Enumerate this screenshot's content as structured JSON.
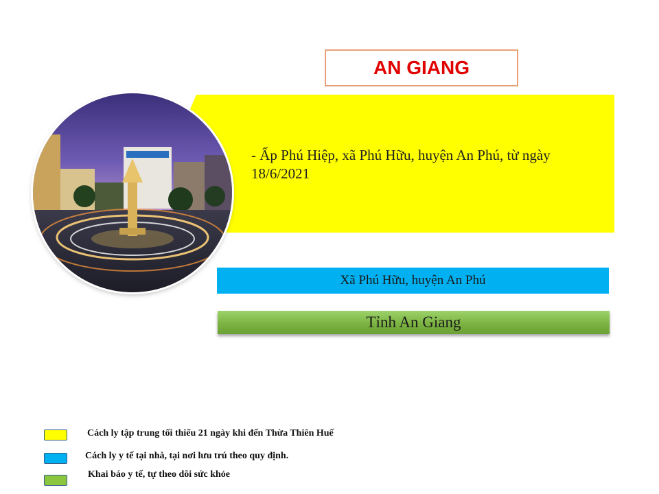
{
  "title": "AN GIANG",
  "yellow_panel": {
    "text": "- Ấp Phú Hiệp, xã Phú Hữu, huyện An Phú, từ ngày 18/6/2021"
  },
  "blue_bar": {
    "text": "Xã Phú Hữu, huyện An Phú"
  },
  "green_bar": {
    "text": "Tỉnh An Giang"
  },
  "legend": [
    {
      "color": "#ffff00",
      "text": "Cách ly tập trung tối thiểu 21 ngày khi đến Thừa Thiên Huế"
    },
    {
      "color": "#00b0f0",
      "text": "Cách ly y tế tại nhà, tại nơi lưu trú theo quy định."
    },
    {
      "color": "#8cc63f",
      "text": "Khai báo y tế, tự theo dõi sức khỏe"
    }
  ],
  "colors": {
    "title": "#e00000",
    "yellow": "#ffff00",
    "blue": "#00b0f0",
    "green": "#7cb342"
  }
}
